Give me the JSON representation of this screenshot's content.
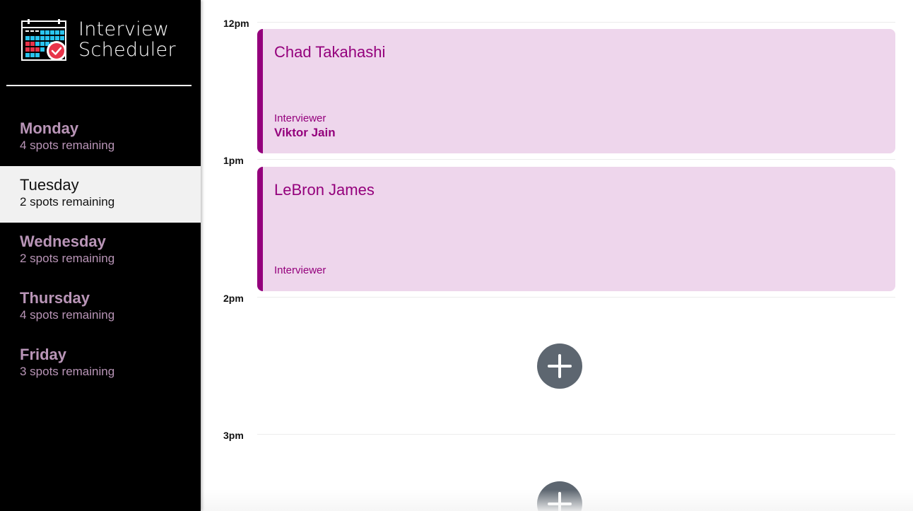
{
  "app": {
    "title_line1": "Interview",
    "title_line2": "Scheduler",
    "logo_icon": "calendar-check-icon"
  },
  "sidebar": {
    "days": [
      {
        "name": "Monday",
        "spots": "4 spots remaining",
        "selected": false
      },
      {
        "name": "Tuesday",
        "spots": "2 spots remaining",
        "selected": true
      },
      {
        "name": "Wednesday",
        "spots": "2 spots remaining",
        "selected": false
      },
      {
        "name": "Thursday",
        "spots": "4 spots remaining",
        "selected": false
      },
      {
        "name": "Friday",
        "spots": "3 spots remaining",
        "selected": false
      }
    ]
  },
  "schedule": {
    "times": [
      "12pm",
      "1pm",
      "2pm",
      "3pm"
    ],
    "appointments": [
      {
        "student": "Chad Takahashi",
        "interviewer_label": "Interviewer",
        "interviewer": "Viktor Jain"
      },
      {
        "student": "LeBron James",
        "interviewer_label": "Interviewer",
        "interviewer": ""
      }
    ],
    "add_icon": "plus-icon"
  },
  "colors": {
    "sidebar_bg": "#000000",
    "selected_day_bg": "#f1f1f1",
    "inactive_day_text": "#b995b7",
    "appointment_bg": "#eed6ec",
    "appointment_accent": "#94007c",
    "add_button_bg": "#5d6670"
  }
}
